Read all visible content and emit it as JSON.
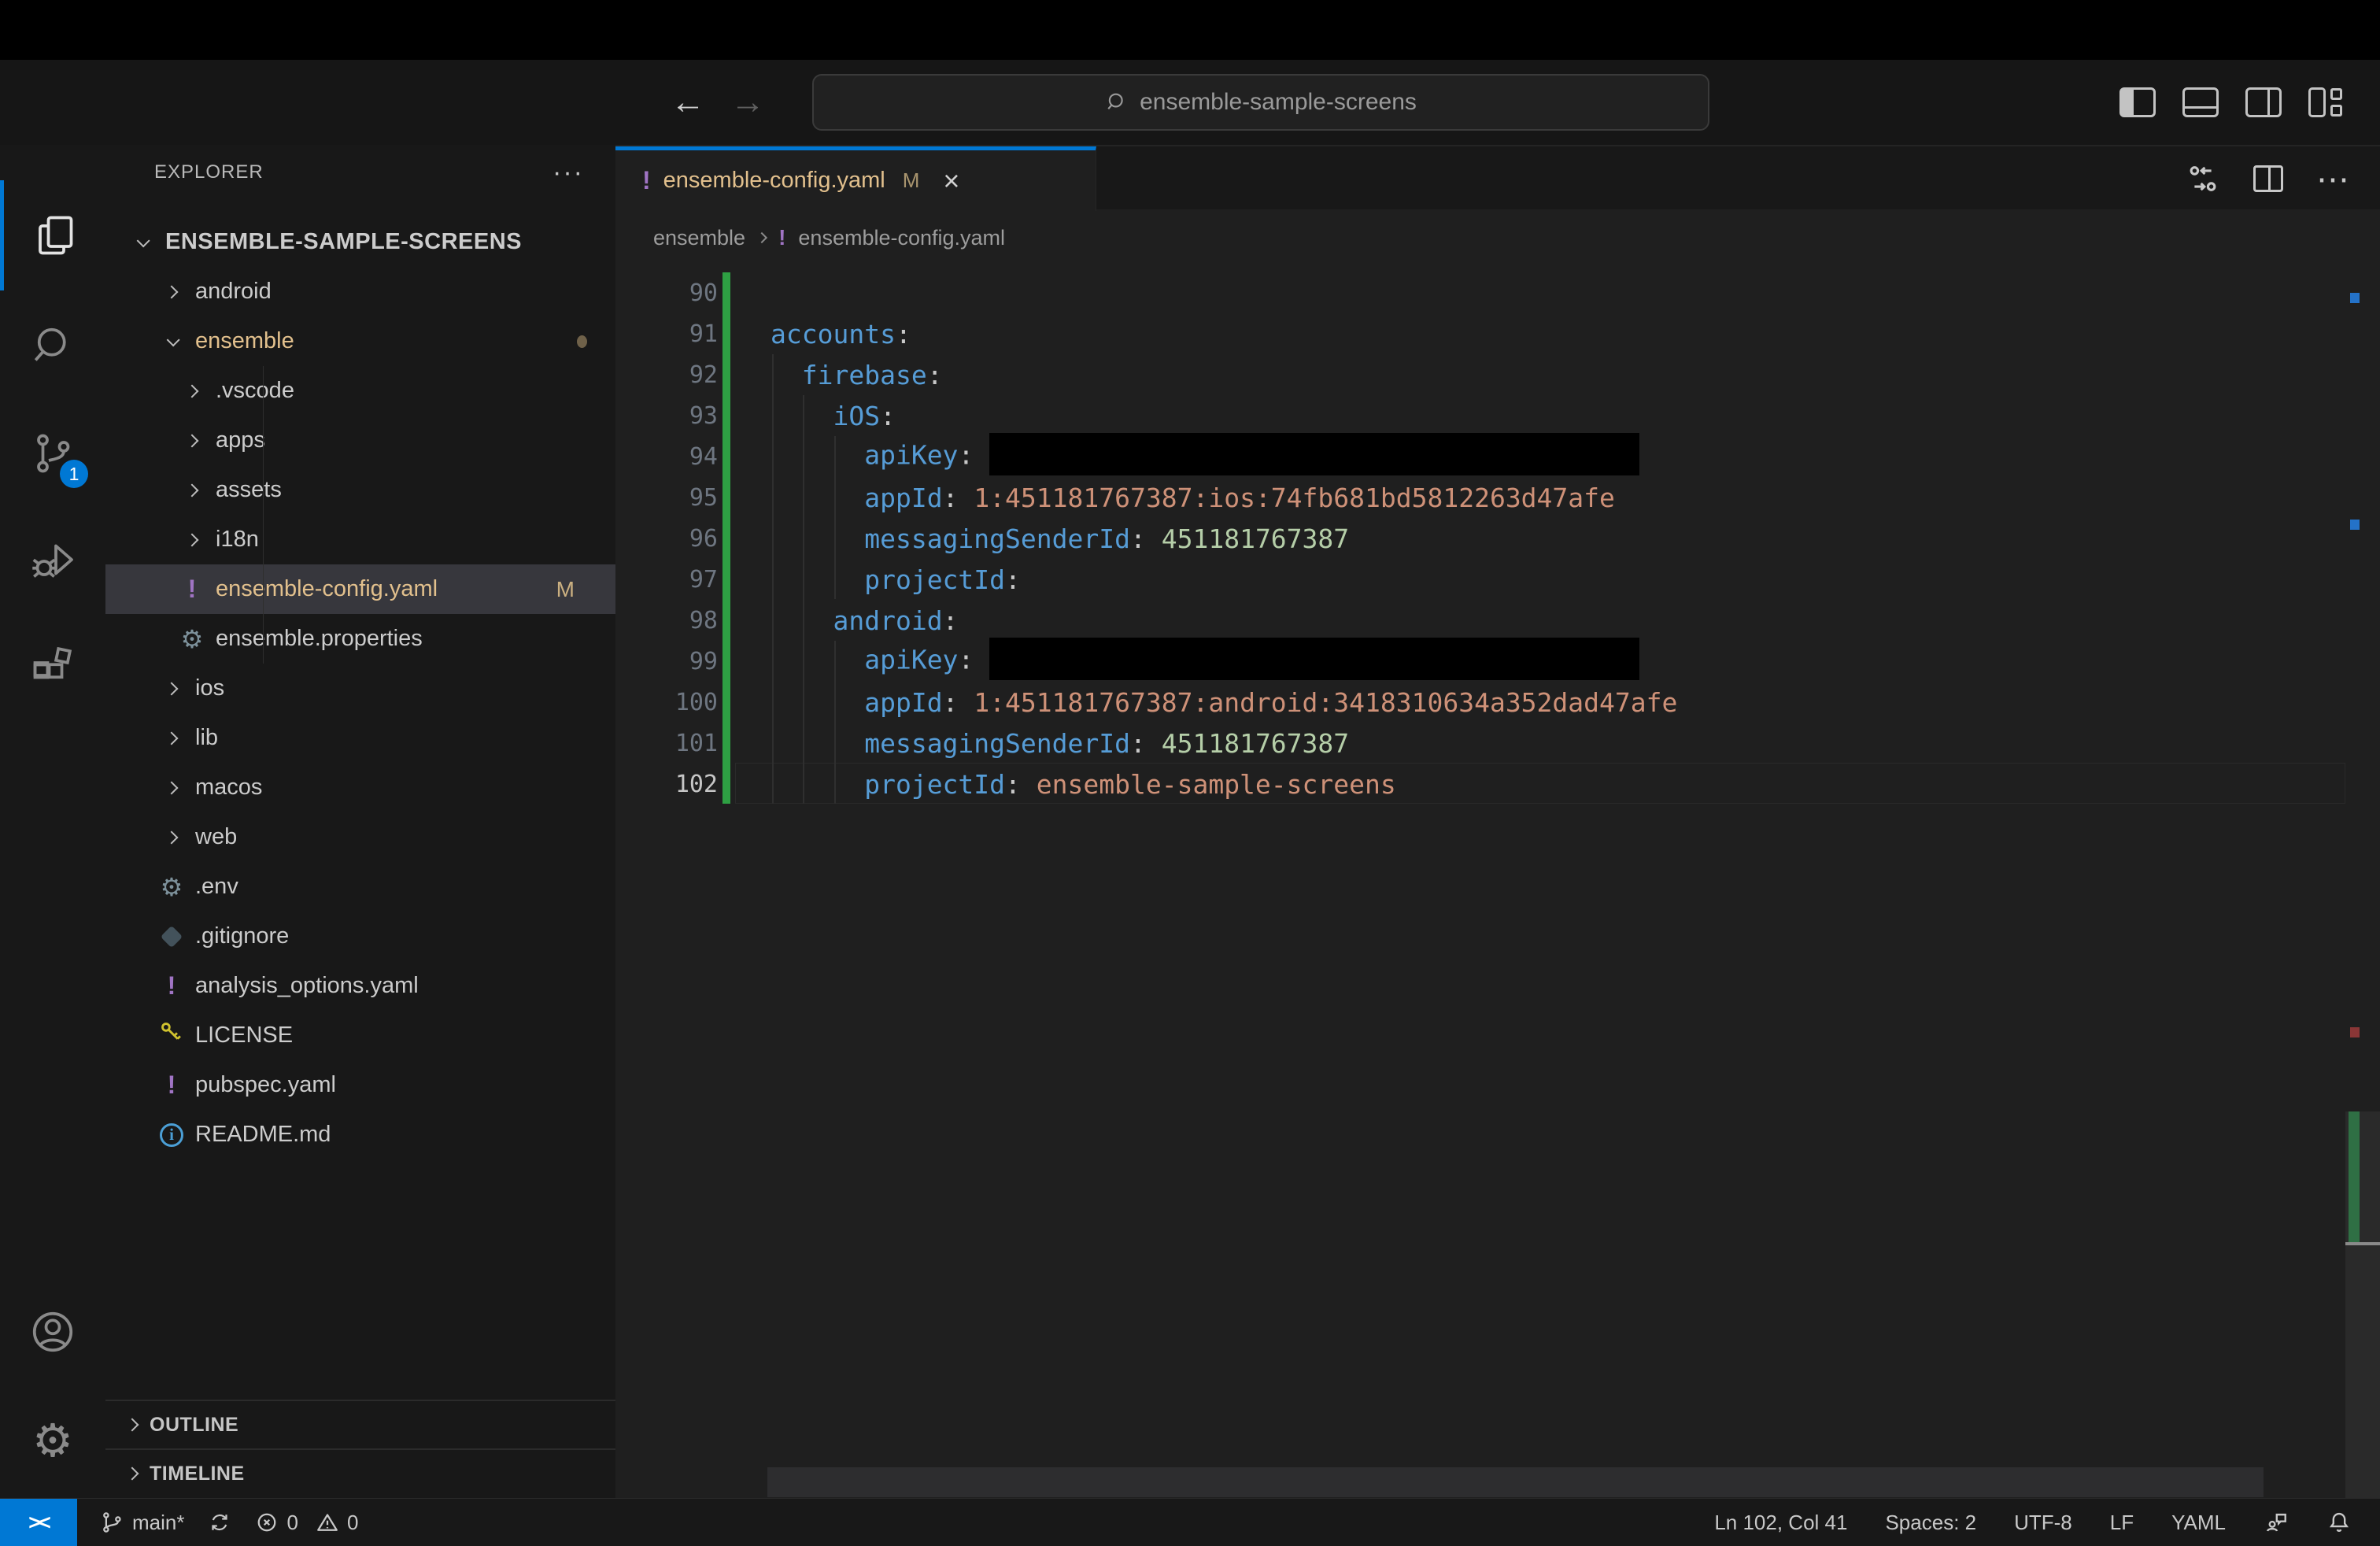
{
  "colors": {
    "accent_blue": "#0078d4",
    "git_modified": "#e2c08d",
    "yaml_icon_purple": "#a074c4",
    "token_key": "#569cd6",
    "token_string": "#ce9178",
    "token_number": "#b5cea8",
    "redaction": "#000000",
    "gutter_added_green": "#2ea043",
    "selected_row": "#37373d"
  },
  "title_bar": {
    "search_value": "ensemble-sample-screens",
    "back_glyph": "←",
    "forward_glyph": "→"
  },
  "activity_bar": {
    "top": [
      {
        "name": "explorer",
        "icon": "files-icon",
        "active": true
      },
      {
        "name": "search",
        "icon": "search-icon",
        "active": false
      },
      {
        "name": "source-control",
        "icon": "source-control-icon",
        "active": false,
        "badge": "1"
      },
      {
        "name": "run-debug",
        "icon": "debug-icon",
        "active": false
      },
      {
        "name": "extensions",
        "icon": "extensions-icon",
        "active": false
      }
    ],
    "bottom": [
      {
        "name": "account",
        "icon": "account-icon"
      },
      {
        "name": "settings",
        "icon": "gear-icon"
      }
    ]
  },
  "explorer": {
    "title": "EXPLORER",
    "more_actions": "···",
    "items": [
      {
        "label": "ENSEMBLE-SAMPLE-SCREENS",
        "icon": "chevron-down",
        "level": 0,
        "root": true
      },
      {
        "label": "android",
        "icon": "chevron-right",
        "level": 1
      },
      {
        "label": "ensemble",
        "icon": "chevron-down",
        "level": 1,
        "modified": true,
        "badge": "dot"
      },
      {
        "label": ".vscode",
        "icon": "chevron-right",
        "level": 2,
        "guide": true
      },
      {
        "label": "apps",
        "icon": "chevron-right",
        "level": 2,
        "guide": true
      },
      {
        "label": "assets",
        "icon": "chevron-right",
        "level": 2,
        "guide": true
      },
      {
        "label": "i18n",
        "icon": "chevron-right",
        "level": 2,
        "guide": true
      },
      {
        "label": "ensemble-config.yaml",
        "icon": "yaml",
        "level": 2,
        "modified": true,
        "selected": true,
        "badge": "M",
        "guide": true
      },
      {
        "label": "ensemble.properties",
        "icon": "gear",
        "level": 2,
        "guide": true
      },
      {
        "label": "ios",
        "icon": "chevron-right",
        "level": 1
      },
      {
        "label": "lib",
        "icon": "chevron-right",
        "level": 1
      },
      {
        "label": "macos",
        "icon": "chevron-right",
        "level": 1
      },
      {
        "label": "web",
        "icon": "chevron-right",
        "level": 1
      },
      {
        "label": ".env",
        "icon": "gear",
        "level": 1
      },
      {
        "label": ".gitignore",
        "icon": "git",
        "level": 1
      },
      {
        "label": "analysis_options.yaml",
        "icon": "yaml",
        "level": 1
      },
      {
        "label": "LICENSE",
        "icon": "key",
        "level": 1
      },
      {
        "label": "pubspec.yaml",
        "icon": "yaml",
        "level": 1
      },
      {
        "label": "README.md",
        "icon": "info",
        "level": 1
      }
    ],
    "sections": [
      {
        "label": "OUTLINE"
      },
      {
        "label": "TIMELINE"
      }
    ]
  },
  "tab": {
    "label": "ensemble-config.yaml",
    "git_badge": "M",
    "close_glyph": "×"
  },
  "breadcrumb": {
    "folder": "ensemble",
    "file": "ensemble-config.yaml"
  },
  "editor": {
    "lines": [
      {
        "n": "90",
        "tokens": []
      },
      {
        "n": "91",
        "tokens": [
          [
            "key",
            "accounts"
          ],
          [
            "punct",
            ":"
          ]
        ]
      },
      {
        "n": "92",
        "tokens": [
          [
            "ws",
            "  "
          ],
          [
            "key",
            "firebase"
          ],
          [
            "punct",
            ":"
          ]
        ]
      },
      {
        "n": "93",
        "tokens": [
          [
            "ws",
            "    "
          ],
          [
            "key",
            "iOS"
          ],
          [
            "punct",
            ":"
          ]
        ]
      },
      {
        "n": "94",
        "tokens": [
          [
            "ws",
            "      "
          ],
          [
            "key",
            "apiKey"
          ],
          [
            "punct",
            ":"
          ],
          [
            "ws",
            " "
          ],
          [
            "redact",
            ""
          ]
        ]
      },
      {
        "n": "95",
        "tokens": [
          [
            "ws",
            "      "
          ],
          [
            "key",
            "appId"
          ],
          [
            "punct",
            ":"
          ],
          [
            "ws",
            " "
          ],
          [
            "str",
            "1:451181767387:ios:74fb681bd5812263d47afe"
          ]
        ]
      },
      {
        "n": "96",
        "tokens": [
          [
            "ws",
            "      "
          ],
          [
            "key",
            "messagingSenderId"
          ],
          [
            "punct",
            ":"
          ],
          [
            "ws",
            " "
          ],
          [
            "num",
            "451181767387"
          ]
        ]
      },
      {
        "n": "97",
        "tokens": [
          [
            "ws",
            "      "
          ],
          [
            "key",
            "projectId"
          ],
          [
            "punct",
            ":"
          ]
        ]
      },
      {
        "n": "98",
        "tokens": [
          [
            "ws",
            "    "
          ],
          [
            "key",
            "android"
          ],
          [
            "punct",
            ":"
          ]
        ]
      },
      {
        "n": "99",
        "tokens": [
          [
            "ws",
            "      "
          ],
          [
            "key",
            "apiKey"
          ],
          [
            "punct",
            ":"
          ],
          [
            "ws",
            " "
          ],
          [
            "redact",
            ""
          ]
        ]
      },
      {
        "n": "100",
        "tokens": [
          [
            "ws",
            "      "
          ],
          [
            "key",
            "appId"
          ],
          [
            "punct",
            ":"
          ],
          [
            "ws",
            " "
          ],
          [
            "str",
            "1:451181767387:android:3418310634a352dad47afe"
          ]
        ]
      },
      {
        "n": "101",
        "tokens": [
          [
            "ws",
            "      "
          ],
          [
            "key",
            "messagingSenderId"
          ],
          [
            "punct",
            ":"
          ],
          [
            "ws",
            " "
          ],
          [
            "num",
            "451181767387"
          ]
        ]
      },
      {
        "n": "102",
        "tokens": [
          [
            "ws",
            "      "
          ],
          [
            "key",
            "projectId"
          ],
          [
            "punct",
            ":"
          ],
          [
            "ws",
            " "
          ],
          [
            "str",
            "ensemble-sample-screens"
          ]
        ],
        "active": true
      }
    ]
  },
  "status_bar": {
    "remote": "><",
    "branch": "main*",
    "errors": "0",
    "warnings": "0",
    "line_col": "Ln 102, Col 41",
    "indentation": "Spaces: 2",
    "encoding": "UTF-8",
    "eol": "LF",
    "language": "YAML"
  }
}
